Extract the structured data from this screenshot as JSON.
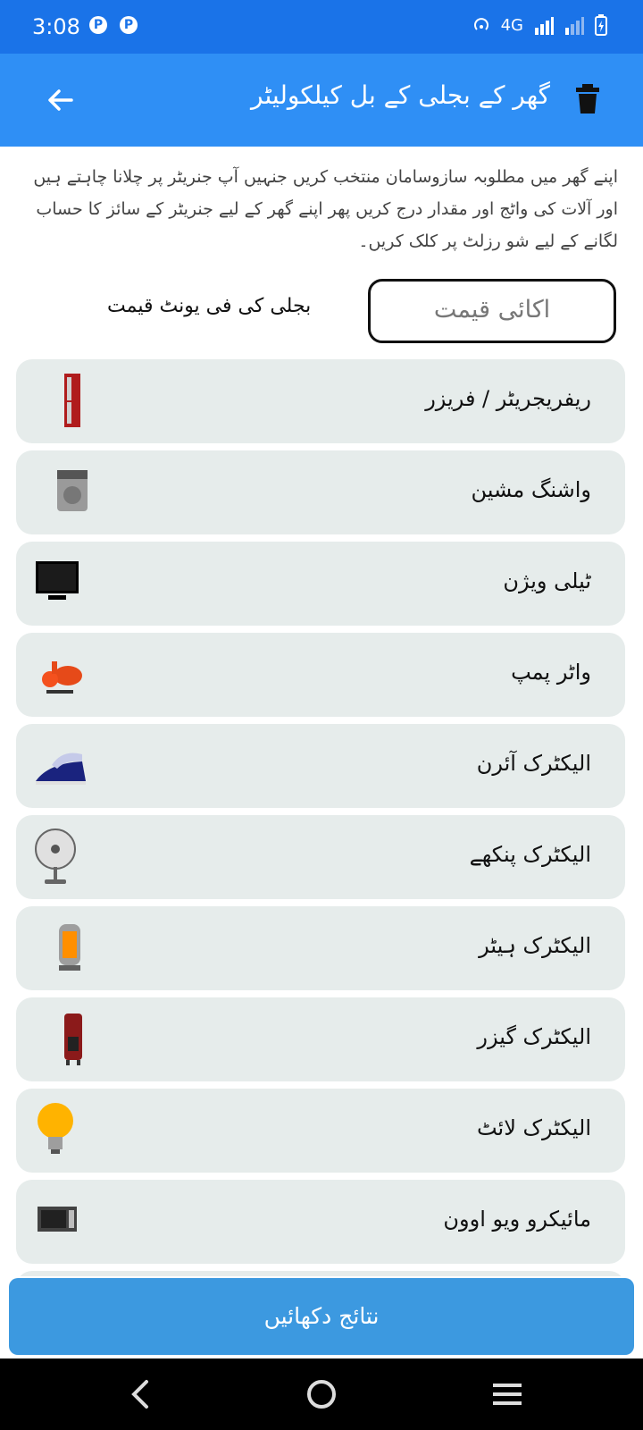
{
  "status_bar": {
    "time": "3:08",
    "network": "4G",
    "icons": [
      "app-notification-icon",
      "app-notification-icon",
      "hotspot-icon",
      "signal-icon",
      "signal-weak-icon",
      "battery-charging-icon"
    ]
  },
  "app_bar": {
    "title": "گھر کے بجلی کے بل کیلکولیٹر",
    "back_icon": "arrow-left-icon",
    "delete_icon": "trash-icon"
  },
  "intro": "اپنے گھر میں مطلوبہ سازوسامان منتخب کریں جنہیں آپ جنریٹر پر چلانا چاہتے ہیں اور آلات کی واٹج اور مقدار درج کریں پھر اپنے گھر کے لیے جنریٹر کے سائز کا حساب لگانے کے لیے شو رزلٹ پر کلک کریں۔",
  "unit_price": {
    "placeholder": "اکائی قیمت",
    "label": "بجلی کی فی یونٹ قیمت"
  },
  "appliances": [
    {
      "label": "ریفریجریٹر / فریزر",
      "icon": "refrigerator-icon"
    },
    {
      "label": "واشنگ مشین",
      "icon": "washing-machine-icon"
    },
    {
      "label": "ٹیلی ویژن",
      "icon": "television-icon"
    },
    {
      "label": "واٹر پمپ",
      "icon": "water-pump-icon"
    },
    {
      "label": "الیکٹرک آئرن",
      "icon": "iron-icon"
    },
    {
      "label": "الیکٹرک پنکھے",
      "icon": "fan-icon"
    },
    {
      "label": "الیکٹرک ہیٹر",
      "icon": "heater-icon"
    },
    {
      "label": "الیکٹرک گیزر",
      "icon": "geyser-icon"
    },
    {
      "label": "الیکٹرک لائٹ",
      "icon": "light-bulb-icon"
    },
    {
      "label": "مائیکرو ویو اوون",
      "icon": "microwave-icon"
    }
  ],
  "result_button": "نتائج دکھائیں",
  "nav_bar": {
    "icons": [
      "nav-back-icon",
      "nav-home-icon",
      "nav-recents-icon"
    ]
  },
  "colors": {
    "status_bar": "#1a73e8",
    "app_bar": "#2f8ff5",
    "row_bg": "#e6eceb",
    "button_bg": "#3c99e0"
  }
}
